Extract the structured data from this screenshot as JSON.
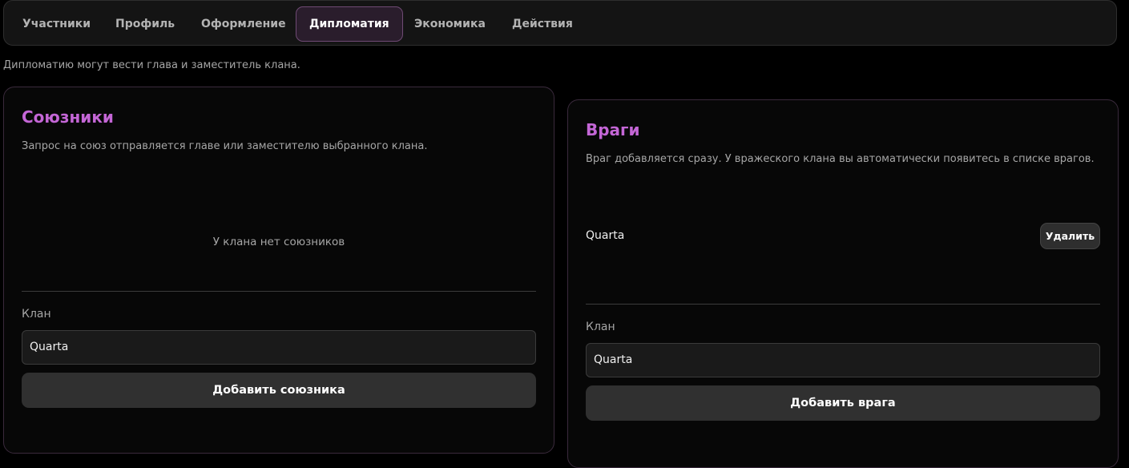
{
  "tabs": [
    {
      "label": "Участники",
      "active": false
    },
    {
      "label": "Профиль",
      "active": false
    },
    {
      "label": "Оформление",
      "active": false
    },
    {
      "label": "Дипломатия",
      "active": true
    },
    {
      "label": "Экономика",
      "active": false
    },
    {
      "label": "Действия",
      "active": false
    }
  ],
  "hint": "Дипломатию могут вести глава и заместитель клана.",
  "allies": {
    "title": "Союзники",
    "description": "Запрос на союз отправляется главе или заместителю выбранного клана.",
    "empty_text": "У клана нет союзников",
    "field_label": "Клан",
    "input_value": "Quarta",
    "button_label": "Добавить союзника"
  },
  "enemies": {
    "title": "Враги",
    "description": "Враг добавляется сразу. У вражеского клана вы автоматически появитесь в списке врагов.",
    "items": [
      {
        "name": "Quarta",
        "remove_label": "Удалить"
      }
    ],
    "field_label": "Клан",
    "input_value": "Quarta",
    "button_label": "Добавить врага"
  },
  "colors": {
    "accent": "#c466d6",
    "background": "#000000",
    "card": "#070707",
    "active_tab_bg": "#2a1d2c",
    "active_tab_border": "#6f4a74"
  }
}
